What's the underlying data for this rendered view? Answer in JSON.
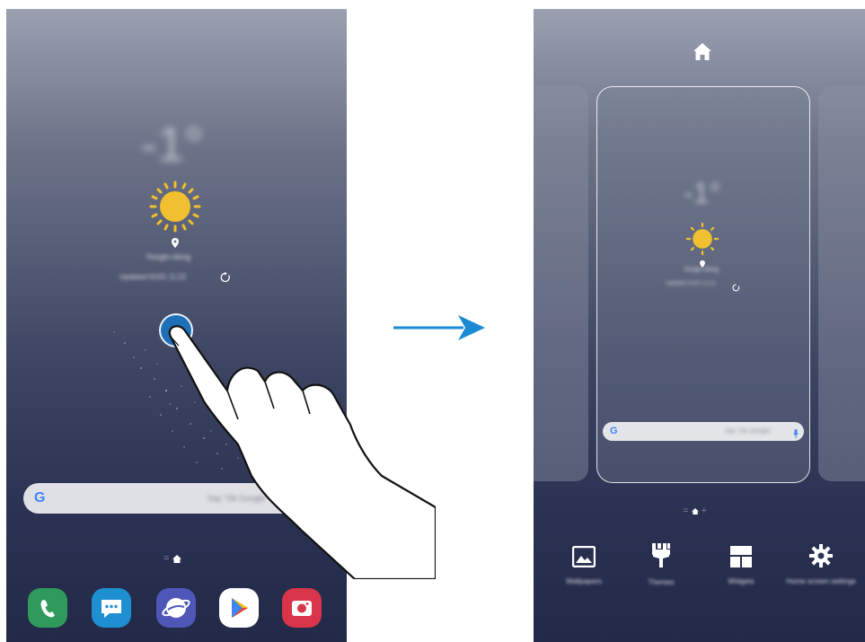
{
  "left_phone": {
    "weather_temp": "-1°",
    "location": "Yongin-dong",
    "updated": "Updated 01/01 11:22",
    "search_placeholder": "Say \"Ok Google\"",
    "google_letter": "G",
    "dock_apps": [
      "Phone",
      "Messages",
      "Internet",
      "Play Store",
      "Camera"
    ]
  },
  "arrow": {
    "color": "#1a8ad4"
  },
  "right_phone": {
    "weather_temp": "-1°",
    "location": "Yongin-dong",
    "updated": "Updated 01/01 11:22",
    "search_placeholder": "Say \"Ok Google\"",
    "google_letter": "G",
    "menu": [
      {
        "label": "Wallpapers",
        "icon": "wallpaper-icon"
      },
      {
        "label": "Themes",
        "icon": "paintbrush-icon"
      },
      {
        "label": "Widgets",
        "icon": "widgets-icon"
      },
      {
        "label": "Home screen settings",
        "icon": "gear-icon"
      }
    ]
  },
  "colors": {
    "sun": "#f0c030",
    "touch_point": "#1f6fb8",
    "google_blue": "#4285f4"
  }
}
